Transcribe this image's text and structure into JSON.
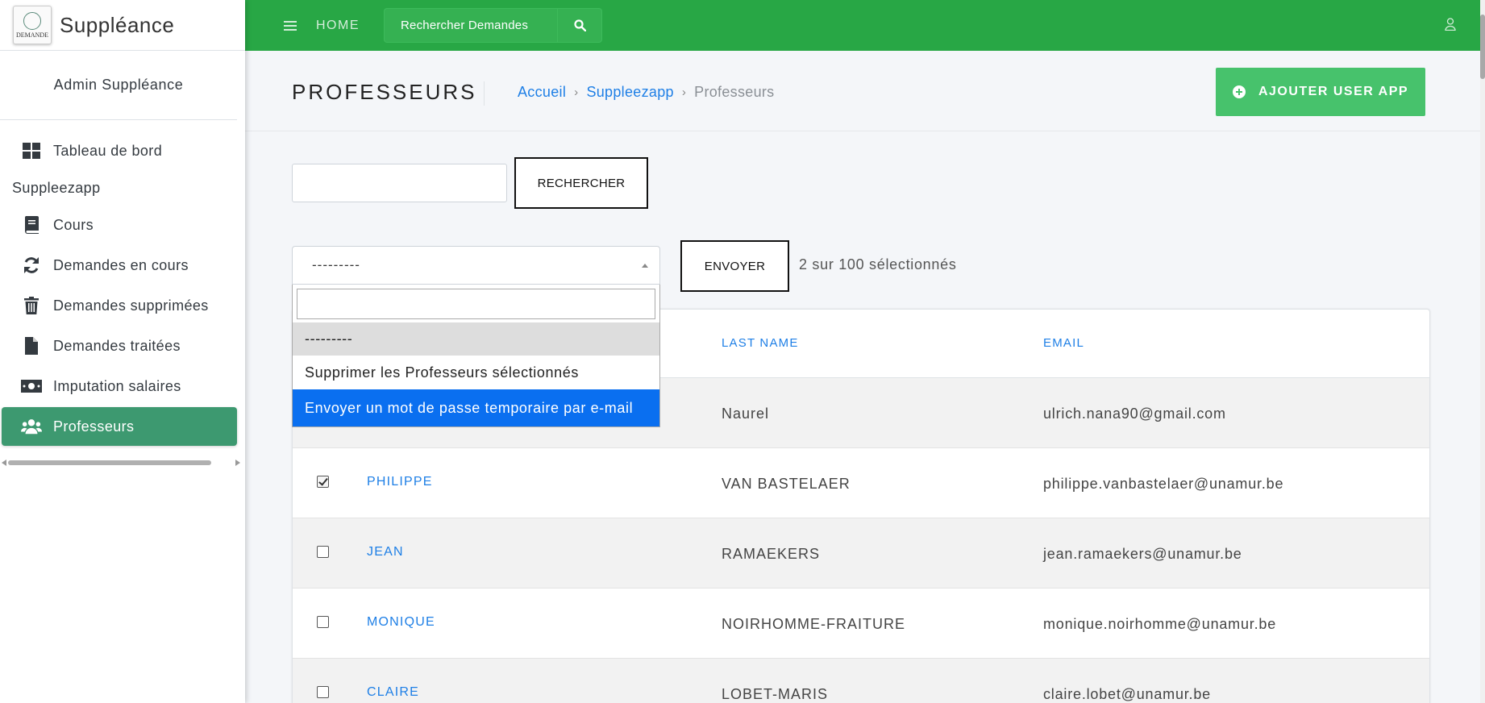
{
  "app": {
    "brand_title": "Suppléance",
    "logo_text": "DEMANDE",
    "user_name": "Admin Suppléance"
  },
  "sidebar": {
    "items": [
      {
        "label": "Tableau de bord",
        "icon": "dashboard-icon"
      },
      {
        "header": "Suppleezapp"
      },
      {
        "label": "Cours",
        "icon": "book-icon"
      },
      {
        "label": "Demandes en cours",
        "icon": "sync-icon"
      },
      {
        "label": "Demandes supprimées",
        "icon": "trash-icon"
      },
      {
        "label": "Demandes traitées",
        "icon": "file-icon"
      },
      {
        "label": "Imputation salaires",
        "icon": "money-bill-icon"
      },
      {
        "label": "Professeurs",
        "icon": "users-icon",
        "active": true
      }
    ]
  },
  "topbar": {
    "home_label": "HOME",
    "search_placeholder": "Rechercher Demandes",
    "accent_color": "#28a745"
  },
  "header": {
    "title": "PROFESSEURS",
    "breadcrumb": [
      "Accueil",
      "Suppleezapp",
      "Professeurs"
    ],
    "add_button": "AJOUTER USER APP"
  },
  "search": {
    "value": "",
    "button": "RECHERCHER"
  },
  "actions": {
    "selected": "---------",
    "send_button": "ENVOYER",
    "selection_count": "2 sur 100 sélectionnés",
    "options": [
      "---------",
      "Supprimer les Professeurs sélectionnés",
      "Envoyer un mot de passe temporaire par e-mail"
    ],
    "highlighted_option": 2
  },
  "table": {
    "columns": [
      "LAST NAME",
      "EMAIL"
    ],
    "rows": [
      {
        "first_name": "",
        "last_name": "Naurel",
        "email": "ulrich.nana90@gmail.com",
        "checked": true
      },
      {
        "first_name": "PHILIPPE",
        "last_name": "VAN BASTELAER",
        "email": "philippe.vanbastelaer@unamur.be",
        "checked": true
      },
      {
        "first_name": "JEAN",
        "last_name": "RAMAEKERS",
        "email": "jean.ramaekers@unamur.be",
        "checked": false
      },
      {
        "first_name": "MONIQUE",
        "last_name": "NOIRHOMME-FRAITURE",
        "email": "monique.noirhomme@unamur.be",
        "checked": false
      },
      {
        "first_name": "CLAIRE",
        "last_name": "LOBET-MARIS",
        "email": "claire.lobet@unamur.be",
        "checked": false
      }
    ]
  }
}
